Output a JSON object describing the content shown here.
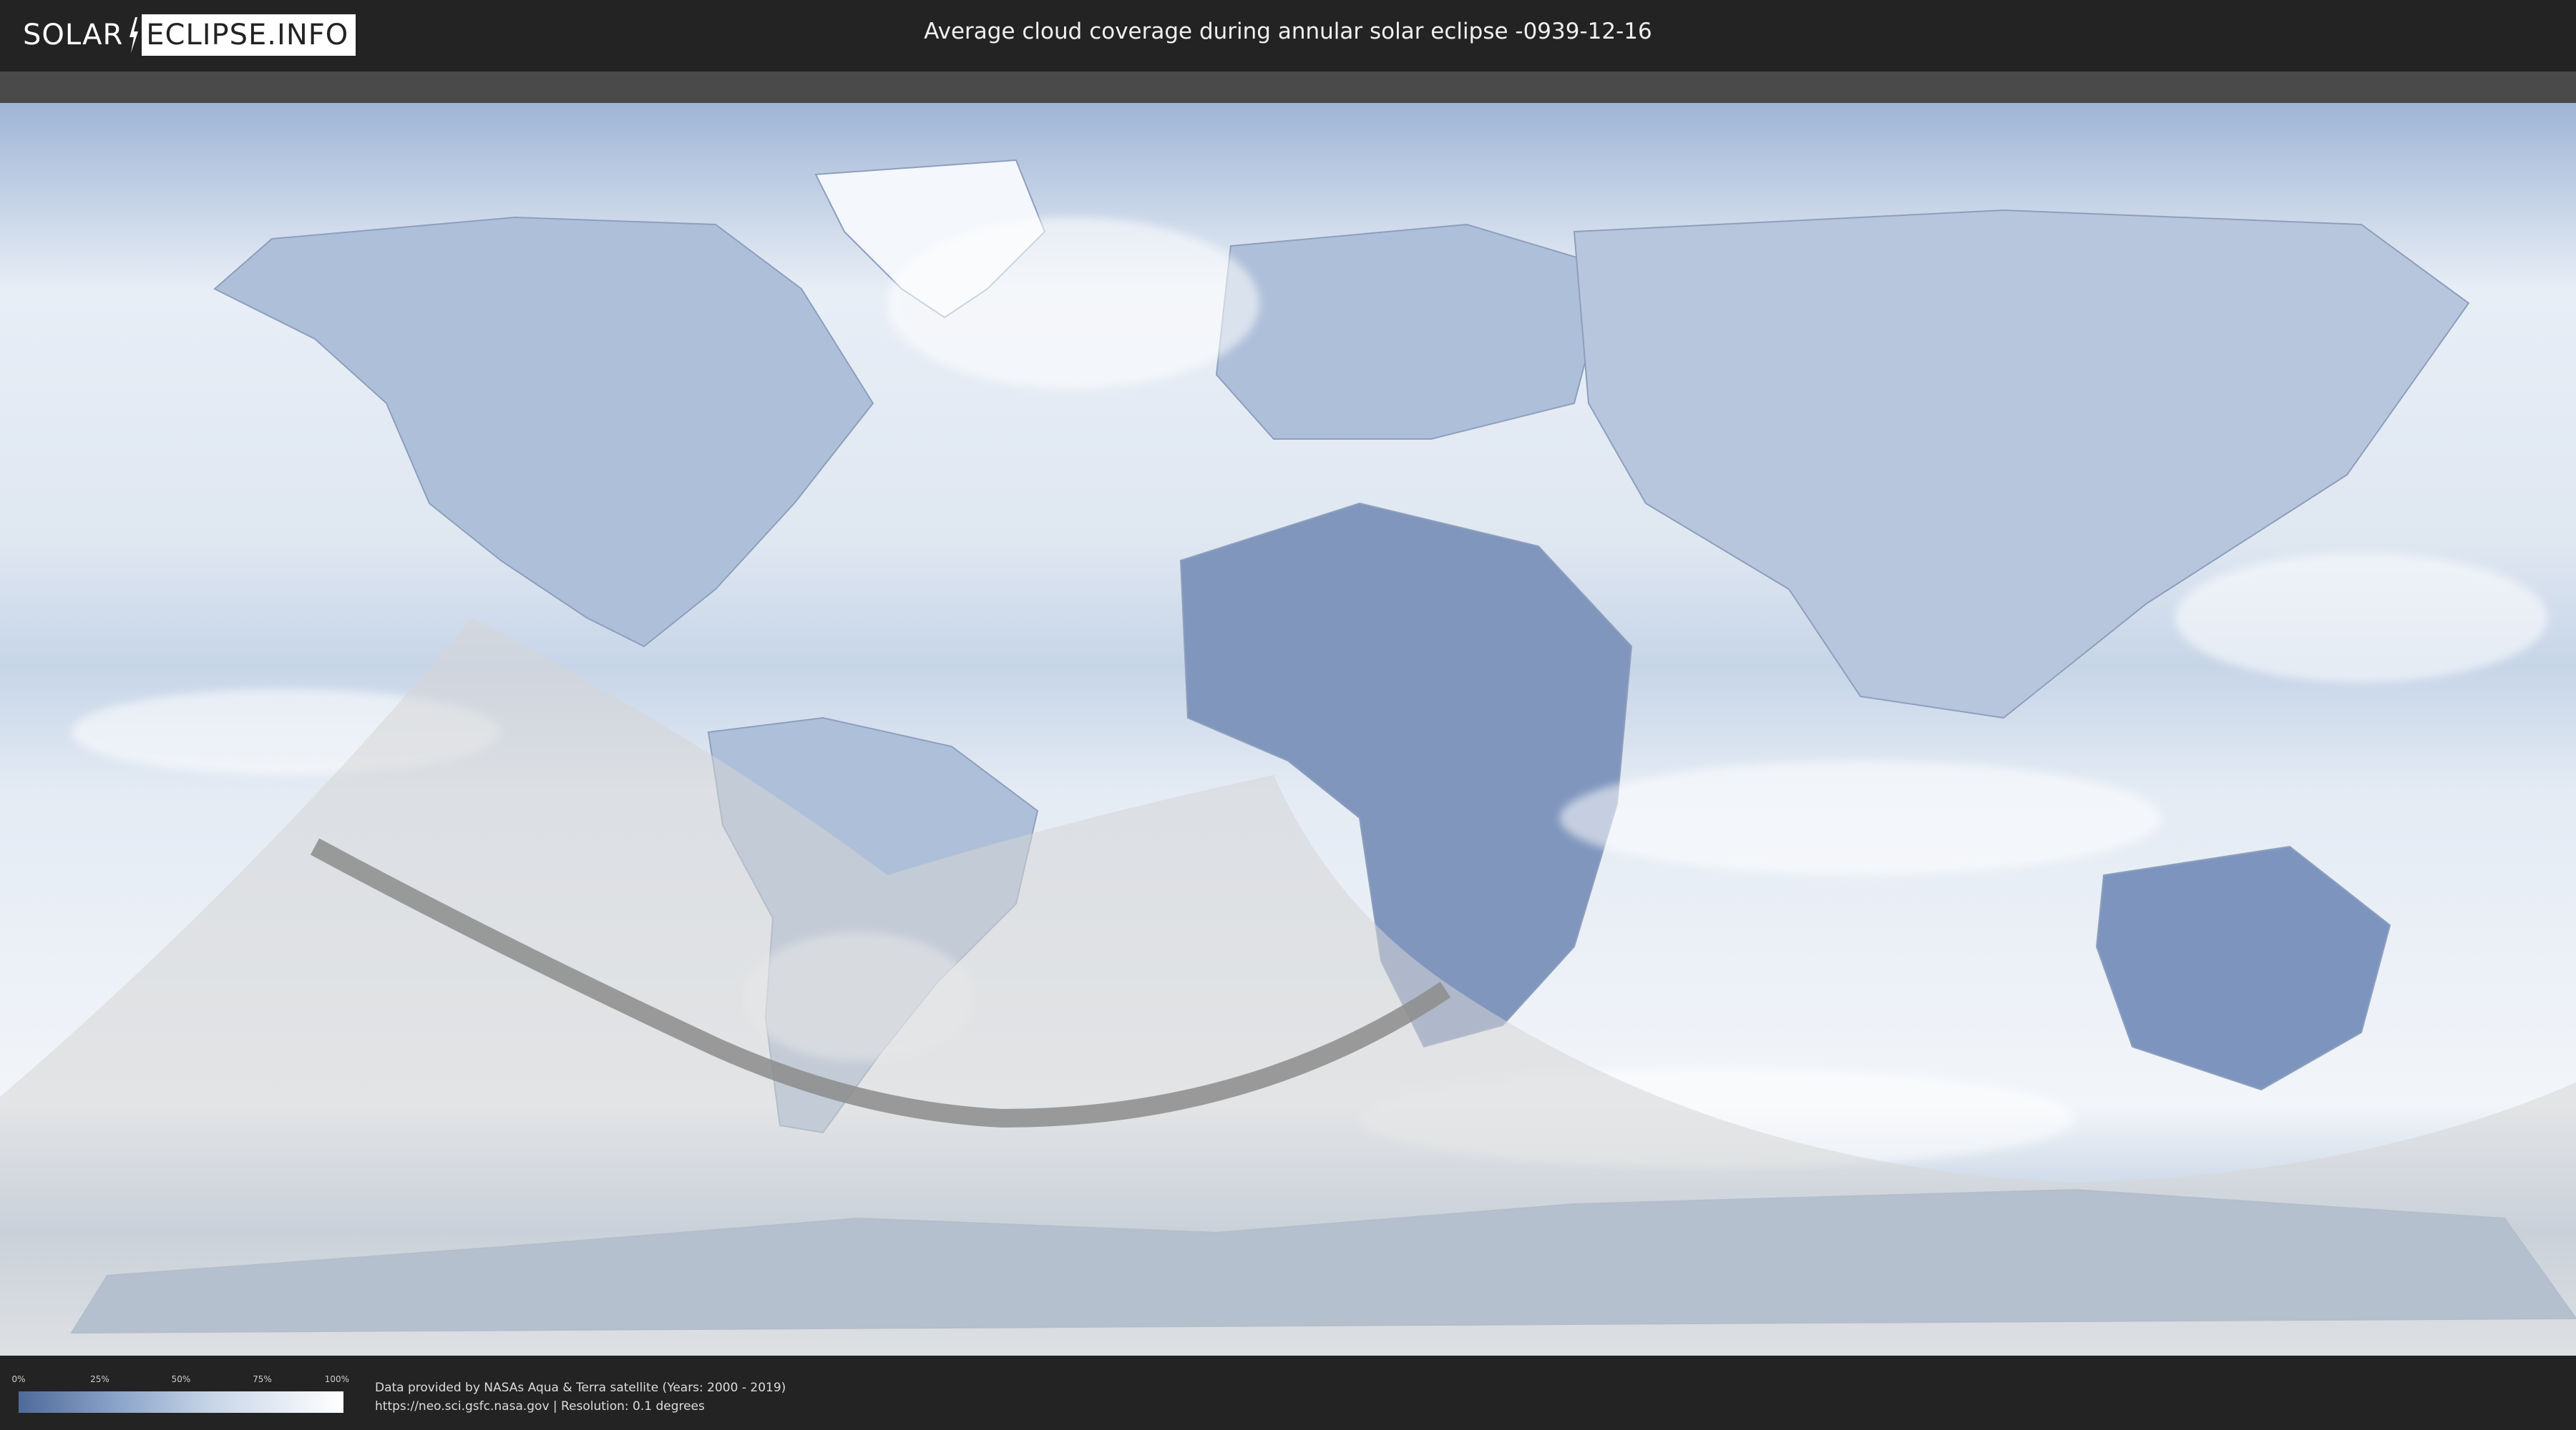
{
  "header": {
    "logo_left": "SOLAR",
    "logo_right": "ECLIPSE.INFO",
    "title": "Average cloud coverage during annular solar eclipse -0939-12-16"
  },
  "legend": {
    "ticks": [
      "0%",
      "25%",
      "50%",
      "75%",
      "100%"
    ],
    "tick_fractions": [
      0,
      0.25,
      0.5,
      0.75,
      1.0
    ],
    "low_color": "#4f6a9a",
    "high_color": "#ffffff"
  },
  "footer": {
    "line1": "Data provided by NASAs Aqua & Terra satellite (Years: 2000 - 2019)",
    "line2": "https://neo.sci.gsfc.nasa.gov | Resolution: 0.1 degrees"
  },
  "colors": {
    "ocean_cloud": "#dbe5f0",
    "dense_cloud": "#f4f7fb",
    "clear_land": "#7d95be",
    "visibility_zone": "#d6d6d6",
    "annular_path": "#8c8c8c"
  }
}
